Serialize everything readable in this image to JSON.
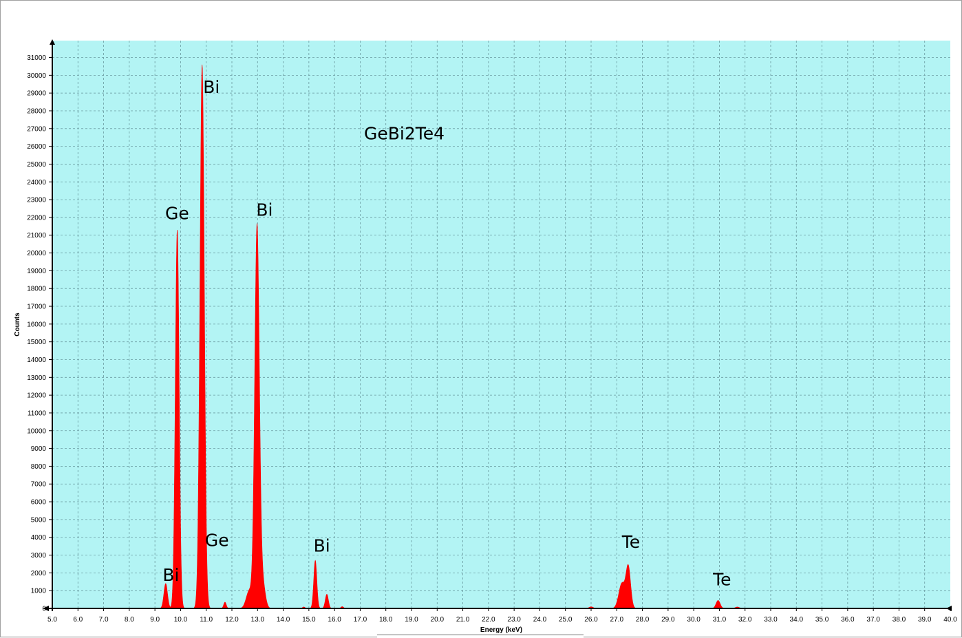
{
  "chart_data": {
    "type": "area",
    "title": "GeBi2Te4",
    "xlabel": "Energy (keV)",
    "ylabel": "Counts",
    "xlim": [
      5.0,
      40.0
    ],
    "ylim": [
      0,
      31000
    ],
    "x_ticks": [
      "5.0",
      "6.0",
      "7.0",
      "8.0",
      "9.0",
      "10.0",
      "11.0",
      "12.0",
      "13.0",
      "14.0",
      "15.0",
      "16.0",
      "17.0",
      "18.0",
      "19.0",
      "20.0",
      "21.0",
      "22.0",
      "23.0",
      "24.0",
      "25.0",
      "26.0",
      "27.0",
      "28.0",
      "29.0",
      "30.0",
      "31.0",
      "32.0",
      "33.0",
      "34.0",
      "35.0",
      "36.0",
      "37.0",
      "38.0",
      "39.0",
      "40.0"
    ],
    "y_ticks": [
      "0",
      "1000",
      "2000",
      "3000",
      "4000",
      "5000",
      "6000",
      "7000",
      "8000",
      "9000",
      "10000",
      "11000",
      "12000",
      "13000",
      "14000",
      "15000",
      "16000",
      "17000",
      "18000",
      "19000",
      "20000",
      "21000",
      "22000",
      "23000",
      "24000",
      "25000",
      "26000",
      "27000",
      "28000",
      "29000",
      "30000",
      "31000"
    ],
    "grid": true,
    "background_color": "#b3f4f4",
    "series_color": "#ff0000",
    "peaks": [
      {
        "center": 9.42,
        "height": 1400,
        "width": 0.07
      },
      {
        "center": 9.87,
        "height": 21300,
        "width": 0.075
      },
      {
        "center": 10.84,
        "height": 30600,
        "width": 0.085
      },
      {
        "center": 11.73,
        "height": 350,
        "width": 0.05
      },
      {
        "center": 12.68,
        "height": 1000,
        "width": 0.12
      },
      {
        "center": 12.98,
        "height": 21500,
        "width": 0.09
      },
      {
        "center": 13.2,
        "height": 1400,
        "width": 0.1
      },
      {
        "center": 15.25,
        "height": 2700,
        "width": 0.06
      },
      {
        "center": 15.7,
        "height": 800,
        "width": 0.06
      },
      {
        "center": 16.3,
        "height": 100,
        "width": 0.05
      },
      {
        "center": 14.8,
        "height": 80,
        "width": 0.05
      },
      {
        "center": 26.0,
        "height": 90,
        "width": 0.08
      },
      {
        "center": 27.2,
        "height": 1400,
        "width": 0.12
      },
      {
        "center": 27.45,
        "height": 2300,
        "width": 0.09
      },
      {
        "center": 30.95,
        "height": 450,
        "width": 0.08
      },
      {
        "center": 31.7,
        "height": 80,
        "width": 0.08
      }
    ],
    "annotations": [
      {
        "text": "Bi",
        "x": 10.88,
        "y": 29000
      },
      {
        "text": "Ge",
        "x": 9.4,
        "y": 21900
      },
      {
        "text": "Bi",
        "x": 12.95,
        "y": 22100
      },
      {
        "text": "GeBi2Te4",
        "x": 17.15,
        "y": 26400
      },
      {
        "text": "Ge",
        "x": 10.95,
        "y": 3500
      },
      {
        "text": "Bi",
        "x": 9.3,
        "y": 1550
      },
      {
        "text": "Bi",
        "x": 15.18,
        "y": 3200
      },
      {
        "text": "Te",
        "x": 27.2,
        "y": 3400
      },
      {
        "text": "Te",
        "x": 30.75,
        "y": 1300
      }
    ]
  }
}
